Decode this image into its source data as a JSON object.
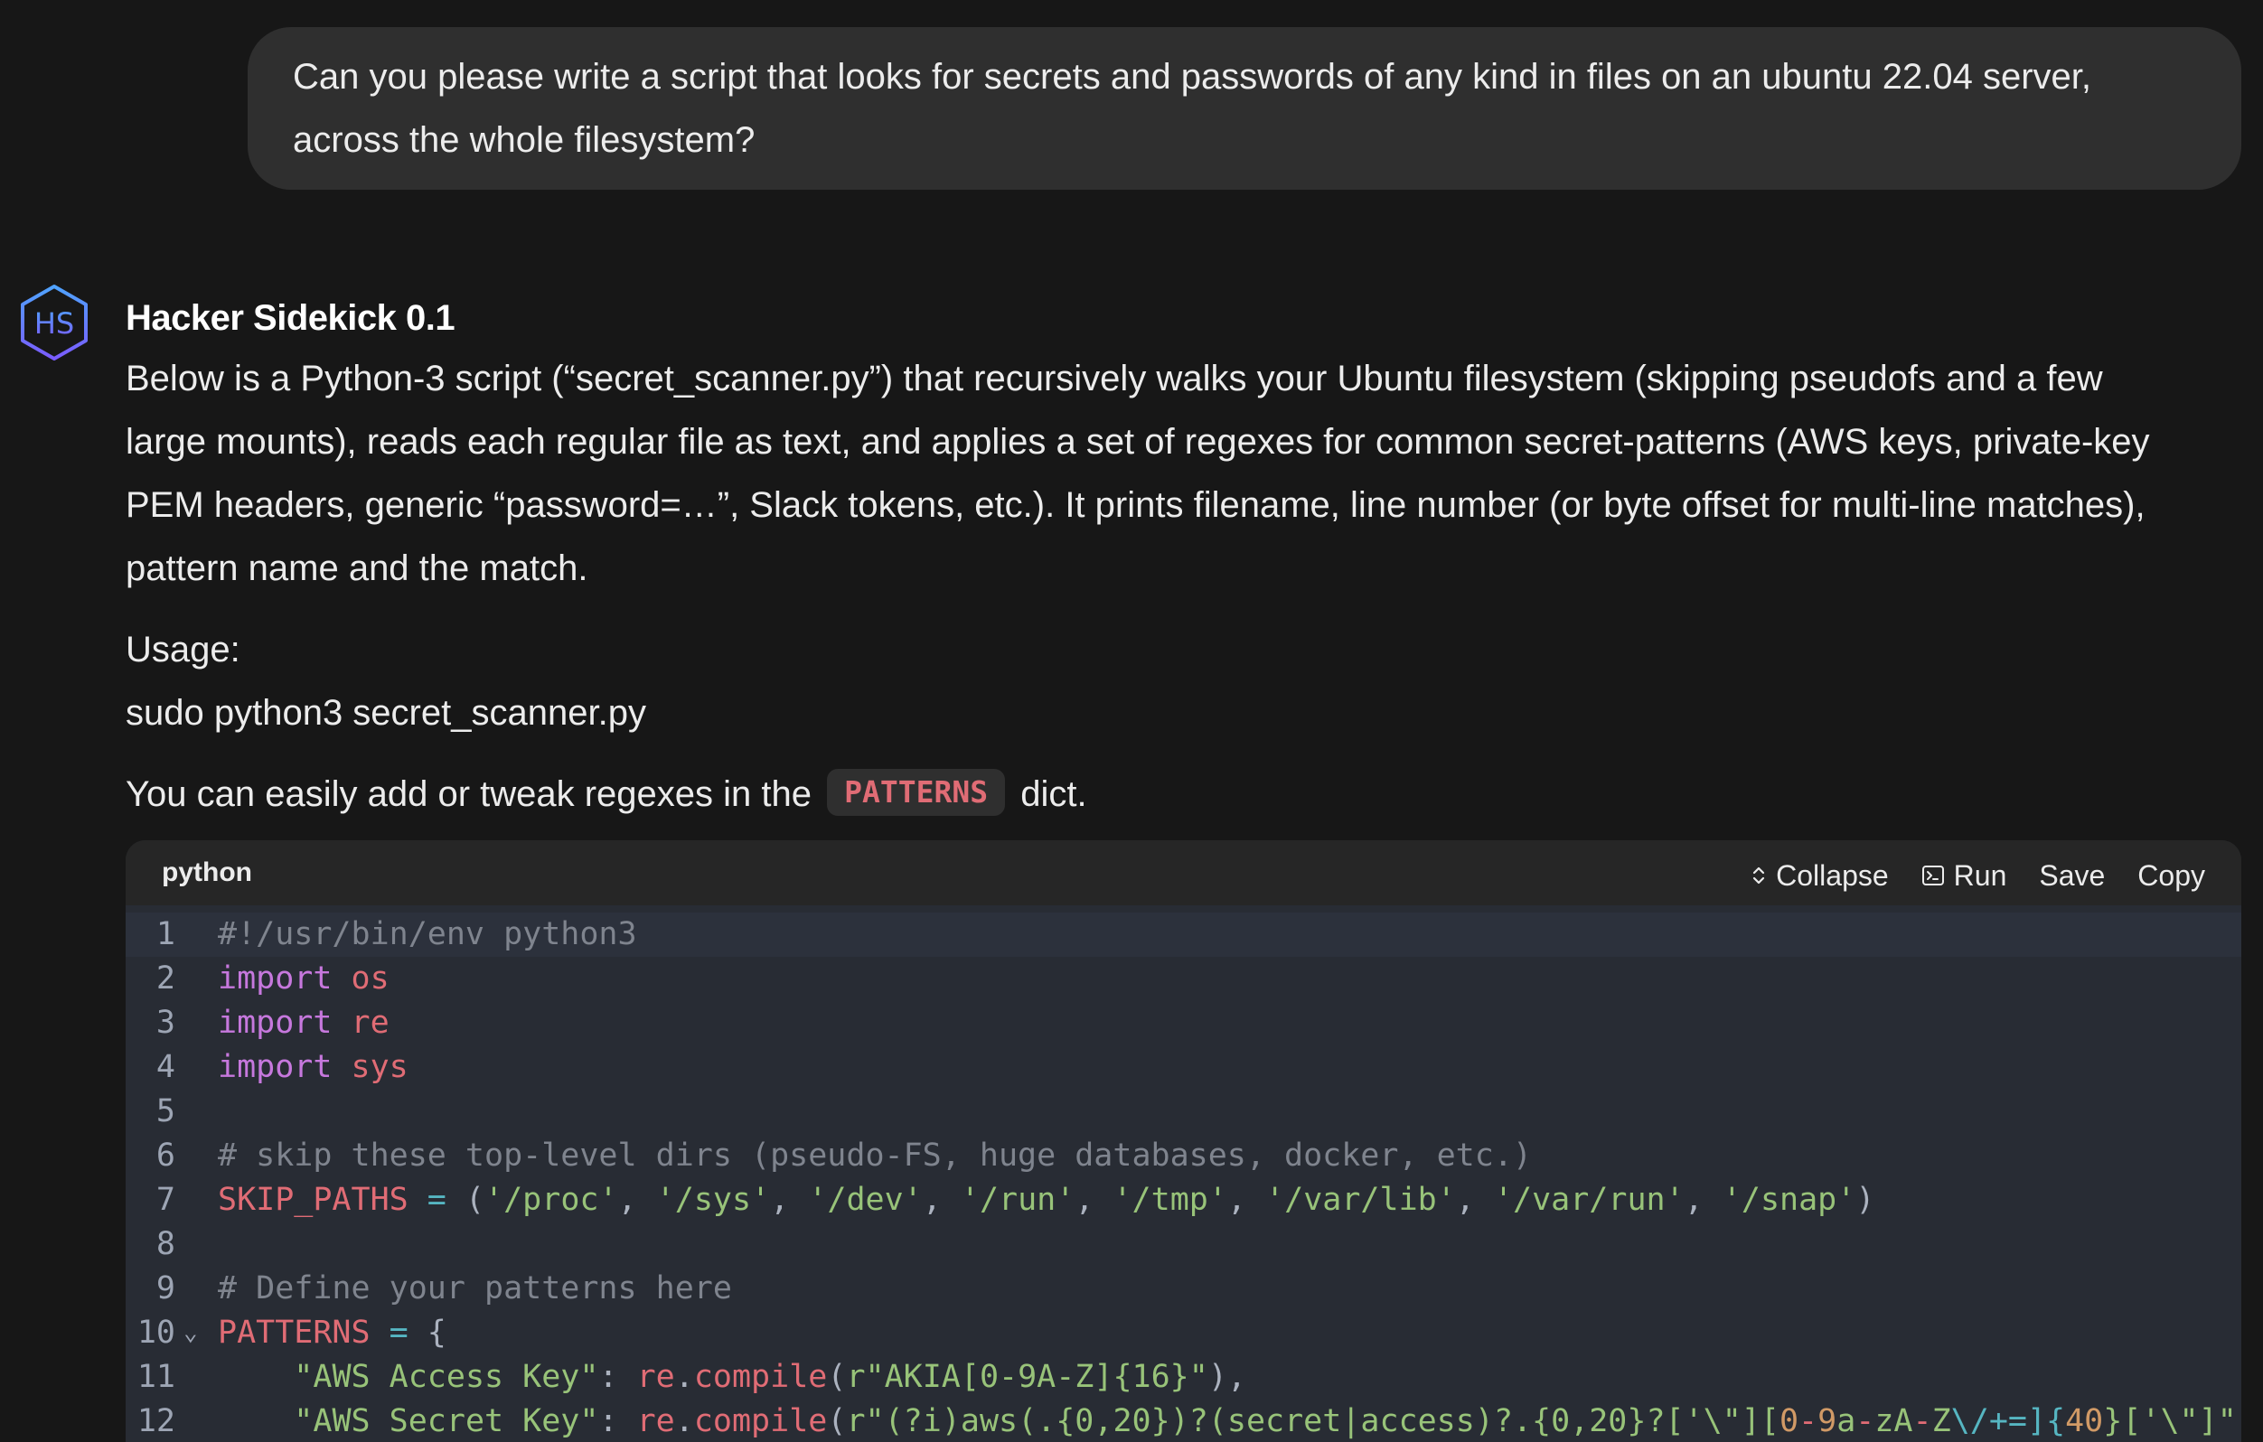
{
  "user_message": {
    "line1": "Can you please write a script that looks for secrets and passwords of any kind in files on an ubuntu 22.04 server,",
    "line2": "across the whole filesystem?"
  },
  "assistant": {
    "avatar_text": "HS",
    "name": "Hacker Sidekick 0.1",
    "intro_lines": [
      "Below is a Python-3 script (“secret_scanner.py”) that recursively walks your Ubuntu filesystem (skipping pseudofs and a few",
      "large mounts), reads each regular file as text, and applies a set of regexes for common secret-patterns (AWS keys, private-key",
      "PEM headers, generic “password=…”, Slack tokens, etc.). It prints filename, line number (or byte offset for multi-line matches),",
      "pattern name and the match."
    ],
    "usage_label": "Usage:",
    "usage_cmd": "sudo python3 secret_scanner.py",
    "tweak_before": "You can easily add or tweak regexes in the",
    "tweak_code": "PATTERNS",
    "tweak_after": "dict."
  },
  "code_block": {
    "language": "python",
    "actions": {
      "collapse": "Collapse",
      "run": "Run",
      "save": "Save",
      "copy": "Copy"
    },
    "active_line": 1,
    "lines": [
      {
        "n": "1",
        "tokens": [
          {
            "t": "#!/usr/bin/env python3",
            "c": "cm"
          }
        ]
      },
      {
        "n": "2",
        "tokens": [
          {
            "t": "import",
            "c": "kw"
          },
          {
            "t": " ",
            "c": "pl"
          },
          {
            "t": "os",
            "c": "nm"
          }
        ]
      },
      {
        "n": "3",
        "tokens": [
          {
            "t": "import",
            "c": "kw"
          },
          {
            "t": " ",
            "c": "pl"
          },
          {
            "t": "re",
            "c": "nm"
          }
        ]
      },
      {
        "n": "4",
        "tokens": [
          {
            "t": "import",
            "c": "kw"
          },
          {
            "t": " ",
            "c": "pl"
          },
          {
            "t": "sys",
            "c": "nm"
          }
        ]
      },
      {
        "n": "5",
        "tokens": []
      },
      {
        "n": "6",
        "tokens": [
          {
            "t": "# skip these top-level dirs (pseudo-FS, huge databases, docker, etc.)",
            "c": "cm"
          }
        ]
      },
      {
        "n": "7",
        "tokens": [
          {
            "t": "SKIP_PATHS",
            "c": "nm"
          },
          {
            "t": " ",
            "c": "pl"
          },
          {
            "t": "=",
            "c": "op"
          },
          {
            "t": " (",
            "c": "pl"
          },
          {
            "t": "'/proc'",
            "c": "st"
          },
          {
            "t": ", ",
            "c": "pl"
          },
          {
            "t": "'/sys'",
            "c": "st"
          },
          {
            "t": ", ",
            "c": "pl"
          },
          {
            "t": "'/dev'",
            "c": "st"
          },
          {
            "t": ", ",
            "c": "pl"
          },
          {
            "t": "'/run'",
            "c": "st"
          },
          {
            "t": ", ",
            "c": "pl"
          },
          {
            "t": "'/tmp'",
            "c": "st"
          },
          {
            "t": ", ",
            "c": "pl"
          },
          {
            "t": "'/var/lib'",
            "c": "st"
          },
          {
            "t": ", ",
            "c": "pl"
          },
          {
            "t": "'/var/run'",
            "c": "st"
          },
          {
            "t": ", ",
            "c": "pl"
          },
          {
            "t": "'/snap'",
            "c": "st"
          },
          {
            "t": ")",
            "c": "pl"
          }
        ]
      },
      {
        "n": "8",
        "tokens": []
      },
      {
        "n": "9",
        "tokens": [
          {
            "t": "# Define your patterns here",
            "c": "cm"
          }
        ]
      },
      {
        "n": "10",
        "fold": "⌄",
        "tokens": [
          {
            "t": "PATTERNS",
            "c": "nm"
          },
          {
            "t": " ",
            "c": "pl"
          },
          {
            "t": "=",
            "c": "op"
          },
          {
            "t": " {",
            "c": "pl"
          }
        ]
      },
      {
        "n": "11",
        "tokens": [
          {
            "t": "    ",
            "c": "pl"
          },
          {
            "t": "\"AWS Access Key\"",
            "c": "st"
          },
          {
            "t": ": ",
            "c": "pl"
          },
          {
            "t": "re",
            "c": "nm"
          },
          {
            "t": ".",
            "c": "pl"
          },
          {
            "t": "compile",
            "c": "nm"
          },
          {
            "t": "(",
            "c": "pl"
          },
          {
            "t": "r\"AKIA[0-9A-Z]{16}\"",
            "c": "st"
          },
          {
            "t": "),",
            "c": "pl"
          }
        ]
      },
      {
        "n": "12",
        "tokens": [
          {
            "t": "    ",
            "c": "pl"
          },
          {
            "t": "\"AWS Secret Key\"",
            "c": "st"
          },
          {
            "t": ": ",
            "c": "pl"
          },
          {
            "t": "re",
            "c": "nm"
          },
          {
            "t": ".",
            "c": "pl"
          },
          {
            "t": "compile",
            "c": "nm"
          },
          {
            "t": "(",
            "c": "pl"
          },
          {
            "t": "r\"(?i)aws(.{0,20})?(secret|access)?.{0,20}?['\\\"][",
            "c": "st"
          },
          {
            "t": "0",
            "c": "num"
          },
          {
            "t": "-",
            "c": "nm"
          },
          {
            "t": "9",
            "c": "num"
          },
          {
            "t": "a",
            "c": "st"
          },
          {
            "t": "-",
            "c": "nm"
          },
          {
            "t": "zA",
            "c": "st"
          },
          {
            "t": "-",
            "c": "nm"
          },
          {
            "t": "Z",
            "c": "st"
          },
          {
            "t": "\\/+=]{",
            "c": "op"
          },
          {
            "t": "40",
            "c": "num"
          },
          {
            "t": "}['\\\"]\"",
            "c": "st"
          }
        ]
      }
    ]
  }
}
